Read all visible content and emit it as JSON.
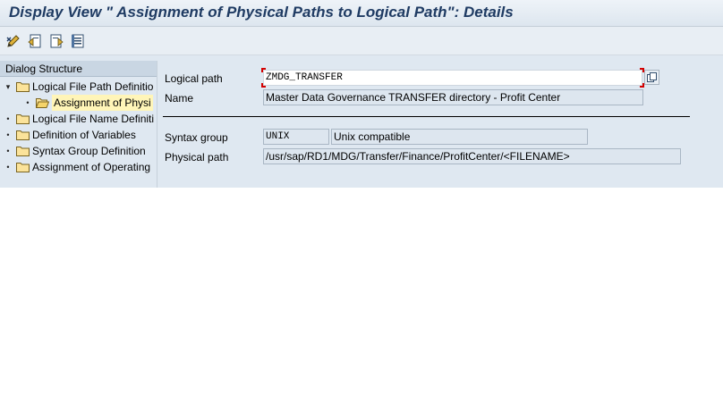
{
  "window": {
    "title": "Display View \" Assignment of Physical Paths to Logical Path\": Details"
  },
  "toolbar": {
    "buttons": [
      {
        "icon": "display-change-icon"
      },
      {
        "icon": "previous-entry-icon"
      },
      {
        "icon": "next-entry-icon"
      },
      {
        "icon": "overview-icon"
      }
    ]
  },
  "dialog_structure": {
    "header": "Dialog Structure",
    "items": [
      {
        "label": "Logical File Path Definitio",
        "expander": "▾",
        "level": 0
      },
      {
        "label": "Assignment of Physi",
        "expander": "•",
        "level": 1,
        "selected": true
      },
      {
        "label": "Logical File Name Definiti",
        "expander": "•",
        "level": 0
      },
      {
        "label": "Definition of Variables",
        "expander": "•",
        "level": 0
      },
      {
        "label": "Syntax Group Definition",
        "expander": "•",
        "level": 0
      },
      {
        "label": "Assignment of Operating",
        "expander": "•",
        "level": 0
      }
    ]
  },
  "details": {
    "logical_path": {
      "label": "Logical path",
      "value": "ZMDG_TRANSFER"
    },
    "name": {
      "label": "Name",
      "value": "Master Data Governance TRANSFER directory - Profit Center"
    },
    "syntax_group": {
      "label": "Syntax group",
      "value": "UNIX",
      "description": "Unix compatible"
    },
    "physical_path": {
      "label": "Physical path",
      "value": "/usr/sap/RD1/MDG/Transfer/Finance/ProfitCenter/<FILENAME>"
    }
  },
  "colors": {
    "title_text": "#1f3b63",
    "workarea_bg": "#dfe8f1",
    "selected_bg": "#fff5b8",
    "focus_marker": "#d40000"
  }
}
